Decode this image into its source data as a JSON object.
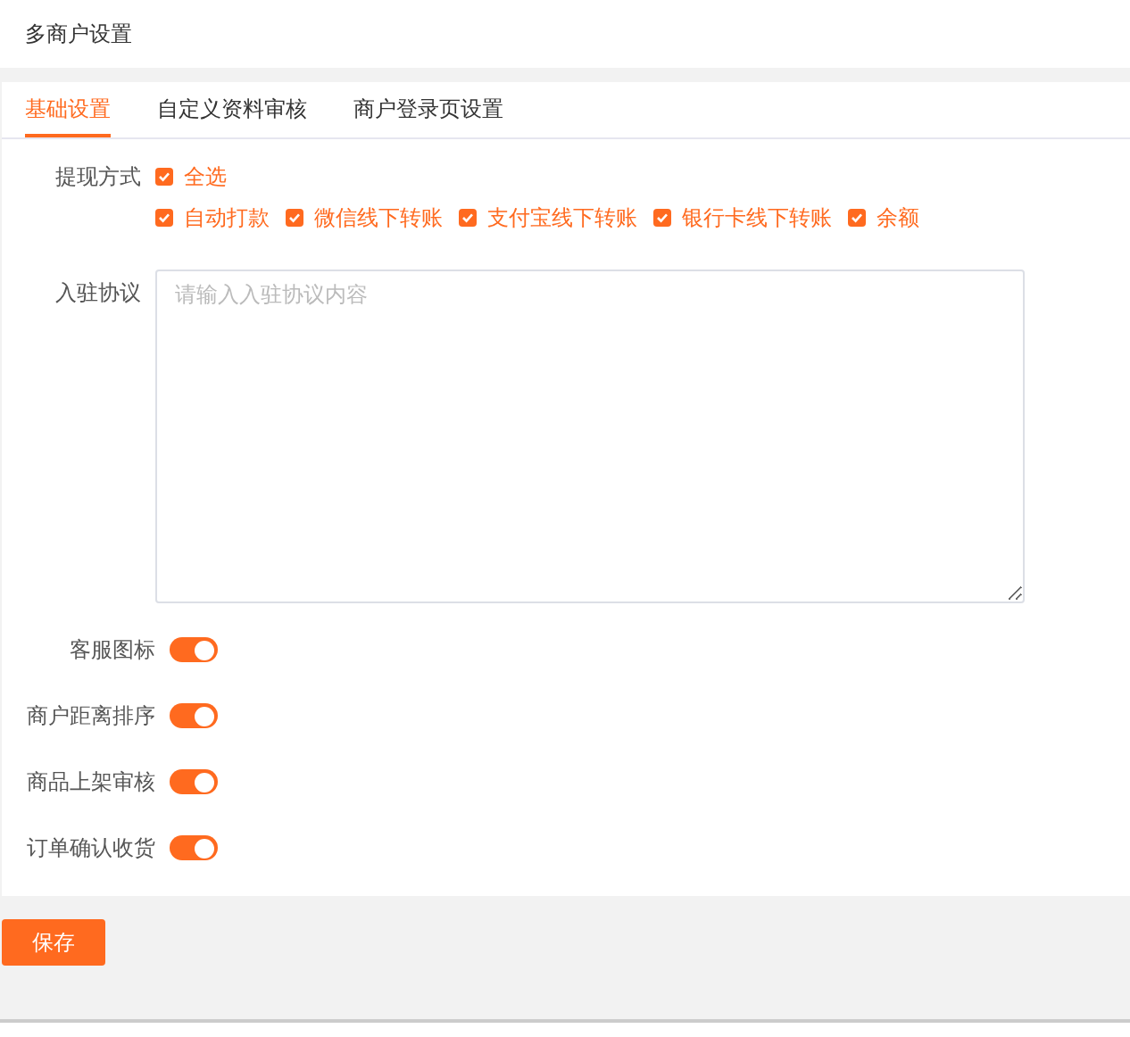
{
  "page_title": "多商户设置",
  "tabs": [
    {
      "label": "基础设置",
      "selected": true
    },
    {
      "label": "自定义资料审核",
      "selected": false
    },
    {
      "label": "商户登录页设置",
      "selected": false
    }
  ],
  "withdraw": {
    "label": "提现方式",
    "select_all": {
      "label": "全选",
      "checked": true
    },
    "options": [
      {
        "label": "自动打款",
        "checked": true
      },
      {
        "label": "微信线下转账",
        "checked": true
      },
      {
        "label": "支付宝线下转账",
        "checked": true
      },
      {
        "label": "银行卡线下转账",
        "checked": true
      },
      {
        "label": "余额",
        "checked": true
      }
    ]
  },
  "agreement": {
    "label": "入驻协议",
    "placeholder": "请输入入驻协议内容"
  },
  "switches": [
    {
      "label": "客服图标",
      "on": true
    },
    {
      "label": "商户距离排序",
      "on": true
    },
    {
      "label": "商品上架审核",
      "on": true
    },
    {
      "label": "订单确认收货",
      "on": true
    }
  ],
  "save_button": "保存"
}
